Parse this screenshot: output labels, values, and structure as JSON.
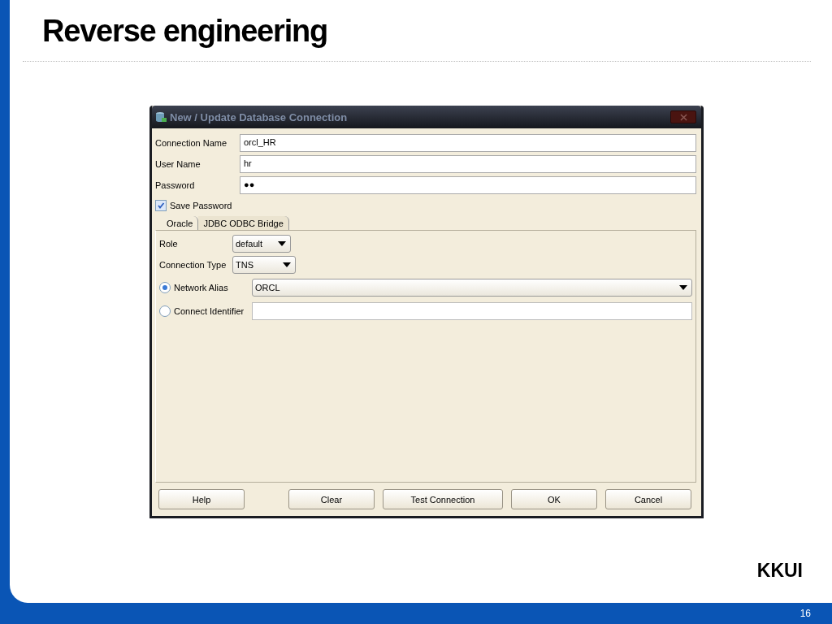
{
  "slide": {
    "title": "Reverse engineering",
    "footer_label": "KKUI",
    "page_number": "16"
  },
  "dialog": {
    "title": "New / Update Database Connection",
    "fields": [
      {
        "label": "Connection Name",
        "value": "orcl_HR"
      },
      {
        "label": "User Name",
        "value": "hr"
      },
      {
        "label": "Password",
        "value": "●●"
      }
    ],
    "save_password": {
      "label": "Save Password",
      "checked": true
    },
    "tabs": [
      {
        "label": "Oracle",
        "selected": true
      },
      {
        "label": "JDBC ODBC Bridge",
        "selected": false
      }
    ],
    "options": [
      {
        "kind": "dropdown",
        "label": "Role",
        "value": "default"
      },
      {
        "kind": "dropdown",
        "label": "Connection Type",
        "value": "TNS"
      }
    ],
    "radios": [
      {
        "label": "Network Alias",
        "selected": true,
        "kind": "dropdown",
        "value": "ORCL"
      },
      {
        "label": "Connect Identifier",
        "selected": false,
        "kind": "text"
      }
    ],
    "buttons": [
      {
        "label": "Help"
      },
      {
        "label": "Clear"
      },
      {
        "label": "Test Connection"
      },
      {
        "label": "OK"
      },
      {
        "label": "Cancel"
      }
    ]
  }
}
